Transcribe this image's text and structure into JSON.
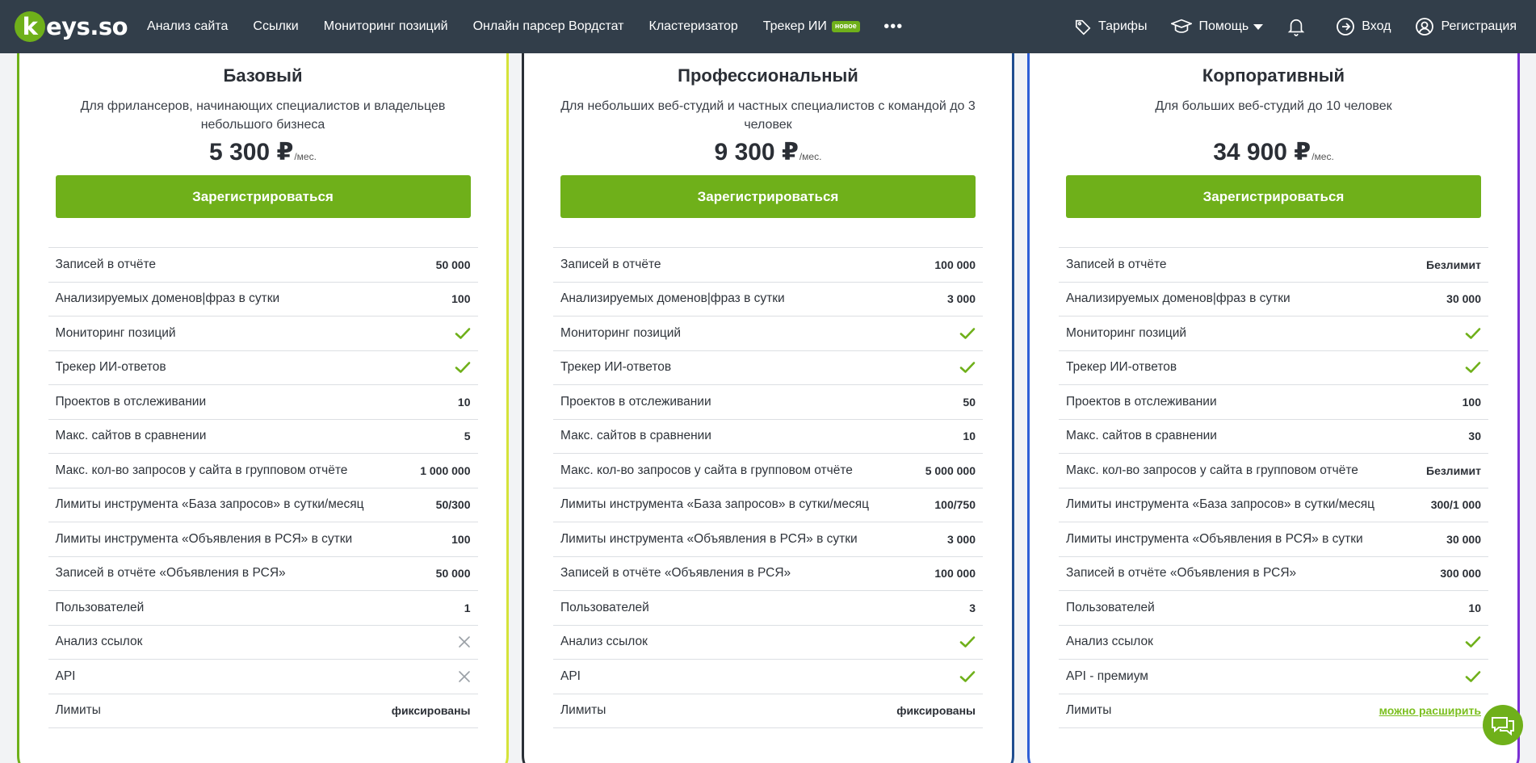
{
  "header": {
    "logo_text": "keys.so",
    "nav": [
      {
        "label": "Анализ сайта"
      },
      {
        "label": "Ссылки"
      },
      {
        "label": "Мониторинг позиций"
      },
      {
        "label": "Онлайн парсер Вордстат"
      },
      {
        "label": "Кластеризатор"
      },
      {
        "label": "Трекер ИИ",
        "badge": "новое"
      }
    ],
    "more": "•••",
    "right": {
      "tariffs": "Тарифы",
      "help": "Помощь",
      "login": "Вход",
      "register": "Регистрация"
    }
  },
  "plans": [
    {
      "title": "Базовый",
      "description": "Для фрилансеров, начинающих специалистов и владельцев небольшого бизнеса",
      "price": "5 300 ₽",
      "per": "/мес.",
      "cta": "Зарегистрироваться",
      "features": [
        {
          "label": "Записей в отчёте",
          "value": "50 000"
        },
        {
          "label": "Анализируемых доменов|фраз в сутки",
          "value": "100"
        },
        {
          "label": "Мониторинг позиций",
          "icon": "check"
        },
        {
          "label": "Трекер ИИ-ответов",
          "icon": "check"
        },
        {
          "label": "Проектов в отслеживании",
          "value": "10"
        },
        {
          "label": "Макс. сайтов в сравнении",
          "value": "5"
        },
        {
          "label": "Макс. кол-во запросов у сайта в групповом отчёте",
          "value": "1 000 000"
        },
        {
          "label": "Лимиты инструмента «База запросов» в сутки/месяц",
          "value": "50/300"
        },
        {
          "label": "Лимиты инструмента «Объявления в РСЯ» в сутки",
          "value": "100"
        },
        {
          "label": "Записей в отчёте «Объявления в РСЯ»",
          "value": "50 000"
        },
        {
          "label": "Пользователей",
          "value": "1"
        },
        {
          "label": "Анализ ссылок",
          "icon": "cross"
        },
        {
          "label": "API",
          "icon": "cross"
        },
        {
          "label": "Лимиты",
          "value": "фиксированы"
        }
      ]
    },
    {
      "title": "Профессиональный",
      "description": "Для небольших веб-студий и частных специалистов с командой до 3 человек",
      "price": "9 300 ₽",
      "per": "/мес.",
      "cta": "Зарегистрироваться",
      "features": [
        {
          "label": "Записей в отчёте",
          "value": "100 000"
        },
        {
          "label": "Анализируемых доменов|фраз в сутки",
          "value": "3 000"
        },
        {
          "label": "Мониторинг позиций",
          "icon": "check"
        },
        {
          "label": "Трекер ИИ-ответов",
          "icon": "check"
        },
        {
          "label": "Проектов в отслеживании",
          "value": "50"
        },
        {
          "label": "Макс. сайтов в сравнении",
          "value": "10"
        },
        {
          "label": "Макс. кол-во запросов у сайта в групповом отчёте",
          "value": "5 000 000"
        },
        {
          "label": "Лимиты инструмента «База запросов» в сутки/месяц",
          "value": "100/750"
        },
        {
          "label": "Лимиты инструмента «Объявления в РСЯ» в сутки",
          "value": "3 000"
        },
        {
          "label": "Записей в отчёте «Объявления в РСЯ»",
          "value": "100 000"
        },
        {
          "label": "Пользователей",
          "value": "3"
        },
        {
          "label": "Анализ ссылок",
          "icon": "check"
        },
        {
          "label": "API",
          "icon": "check"
        },
        {
          "label": "Лимиты",
          "value": "фиксированы"
        }
      ]
    },
    {
      "title": "Корпоративный",
      "description": "Для больших веб-студий до 10 человек",
      "price": "34 900 ₽",
      "per": "/мес.",
      "cta": "Зарегистрироваться",
      "features": [
        {
          "label": "Записей в отчёте",
          "value": "Безлимит"
        },
        {
          "label": "Анализируемых доменов|фраз в сутки",
          "value": "30 000"
        },
        {
          "label": "Мониторинг позиций",
          "icon": "check"
        },
        {
          "label": "Трекер ИИ-ответов",
          "icon": "check"
        },
        {
          "label": "Проектов в отслеживании",
          "value": "100"
        },
        {
          "label": "Макс. сайтов в сравнении",
          "value": "30"
        },
        {
          "label": "Макс. кол-во запросов у сайта в групповом отчёте",
          "value": "Безлимит"
        },
        {
          "label": "Лимиты инструмента «База запросов» в сутки/месяц",
          "value": "300/1 000"
        },
        {
          "label": "Лимиты инструмента «Объявления в РСЯ» в сутки",
          "value": "30 000"
        },
        {
          "label": "Записей в отчёте «Объявления в РСЯ»",
          "value": "300 000"
        },
        {
          "label": "Пользователей",
          "value": "10"
        },
        {
          "label": "Анализ ссылок",
          "icon": "check"
        },
        {
          "label": "API - премиум",
          "icon": "check"
        },
        {
          "label": "Лимиты",
          "value": "можно расширить",
          "link": true
        }
      ]
    }
  ],
  "colors": {
    "header_bg": "#323e4a",
    "accent_green": "#6fb01a",
    "check_green": "#6fb01a",
    "cross_gray": "#9aa0a6"
  }
}
